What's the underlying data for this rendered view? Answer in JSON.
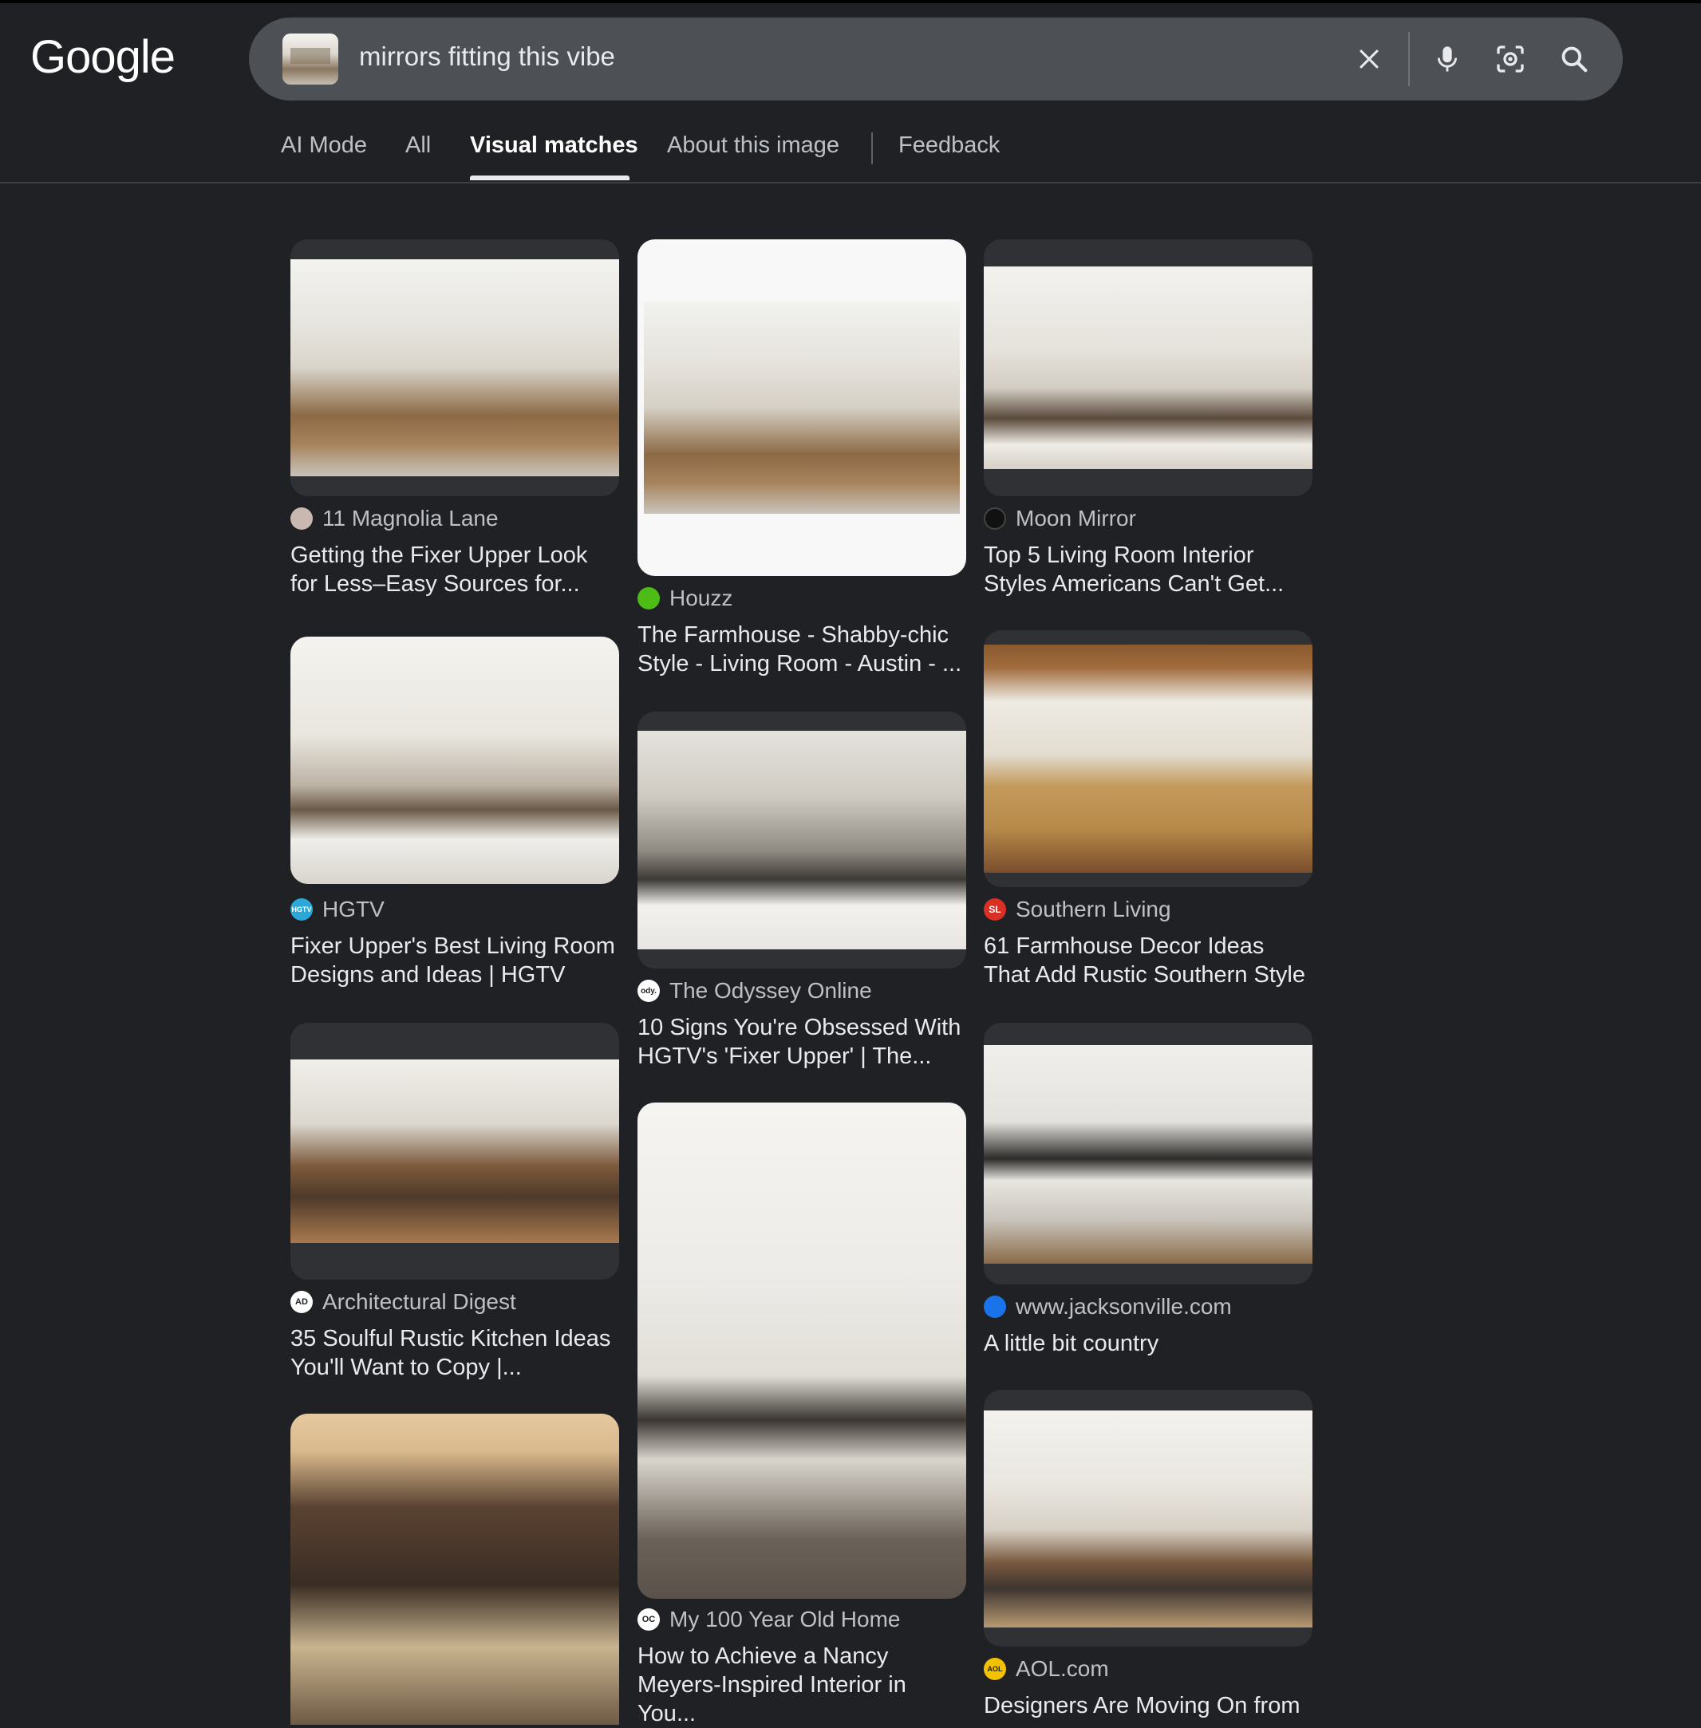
{
  "header": {
    "logo_text": "Google",
    "search_query": "mirrors fitting this vibe",
    "icons": [
      "close-icon",
      "microphone-icon",
      "lens-icon",
      "search-icon"
    ]
  },
  "tabs": [
    {
      "label": "AI Mode"
    },
    {
      "label": "All"
    },
    {
      "label": "Visual matches",
      "active": true
    },
    {
      "label": "About this image"
    },
    {
      "label": "Feedback"
    }
  ],
  "results": [
    {
      "source": "11 Magnolia Lane",
      "title": "Getting the Fixer Upper Look for Less–Easy Sources for...",
      "favicon_color": "#c9b8b0"
    },
    {
      "source": "Houzz",
      "title": "The Farmhouse - Shabby-chic Style - Living Room - Austin - ...",
      "favicon_color": "#4dbc15"
    },
    {
      "source": "Moon Mirror",
      "title": "Top 5 Living Room Interior Styles Americans Can't Get...",
      "favicon_color": "#111111"
    },
    {
      "source": "HGTV",
      "title": "Fixer Upper's Best Living Room Designs and Ideas | HGTV",
      "favicon_color": "#2aa8d8"
    },
    {
      "source": "The Odyssey Online",
      "title": "10 Signs You're Obsessed With HGTV's 'Fixer Upper' | The...",
      "favicon_color": "#ffffff"
    },
    {
      "source": "Southern Living",
      "title": "61 Farmhouse Decor Ideas That Add Rustic Southern Style",
      "favicon_color": "#d93025"
    },
    {
      "source": "Architectural Digest",
      "title": "35 Soulful Rustic Kitchen Ideas You'll Want to Copy |...",
      "favicon_color": "#ffffff"
    },
    {
      "source": "My 100 Year Old Home",
      "title": "How to Achieve a Nancy Meyers-Inspired Interior in You...",
      "favicon_color": "#ffffff"
    },
    {
      "source": "www.jacksonville.com",
      "title": "A little bit country",
      "favicon_color": "#1a73e8"
    },
    {
      "source": "AOL.com",
      "title": "Designers Are Moving On from",
      "favicon_color": "#f2c100"
    },
    {
      "source": "",
      "title": "",
      "favicon_color": "#5f6368"
    }
  ],
  "favicon_glyphs": {
    "hgtv": "HGTV",
    "southern": "SL",
    "odyssey": "ody.",
    "ad": "AD",
    "aol": "AOL",
    "myhome": "OC"
  }
}
